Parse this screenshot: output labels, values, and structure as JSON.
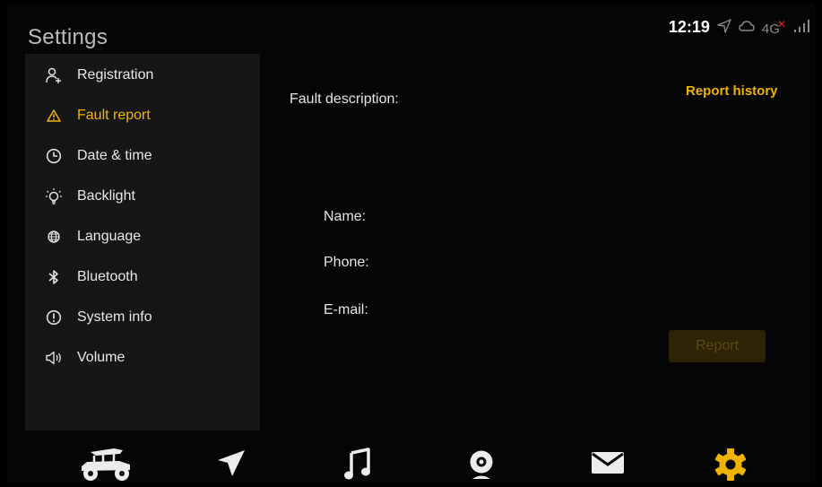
{
  "header": {
    "title": "Settings"
  },
  "status_bar": {
    "time": "12:19",
    "network": "4G"
  },
  "sidebar": {
    "items": [
      {
        "label": "Registration",
        "icon": "user-add-icon",
        "active": false
      },
      {
        "label": "Fault report",
        "icon": "warning-icon",
        "active": true
      },
      {
        "label": "Date & time",
        "icon": "clock-icon",
        "active": false
      },
      {
        "label": "Backlight",
        "icon": "lightbulb-icon",
        "active": false
      },
      {
        "label": "Language",
        "icon": "globe-icon",
        "active": false
      },
      {
        "label": "Bluetooth",
        "icon": "bluetooth-icon",
        "active": false
      },
      {
        "label": "System info",
        "icon": "info-icon",
        "active": false
      },
      {
        "label": "Volume",
        "icon": "speaker-icon",
        "active": false
      }
    ]
  },
  "form": {
    "fault_description_label": "Fault description:",
    "name_label": "Name:",
    "phone_label": "Phone:",
    "email_label": "E-mail:",
    "report_history_label": "Report history",
    "report_button_label": "Report",
    "report_button_enabled": false
  },
  "bottom_nav": {
    "items": [
      {
        "icon": "vehicle-icon",
        "active": false
      },
      {
        "icon": "navigation-icon",
        "active": false
      },
      {
        "icon": "music-icon",
        "active": false
      },
      {
        "icon": "camera-icon",
        "active": false
      },
      {
        "icon": "mail-icon",
        "active": false
      },
      {
        "icon": "settings-icon",
        "active": true
      }
    ]
  },
  "colors": {
    "accent": "#f0b400",
    "background": "#050505",
    "sidebar": "#161616",
    "text": "#e8e8e8",
    "disabled_button_bg": "#2e2304",
    "disabled_button_text": "#5b4913"
  }
}
